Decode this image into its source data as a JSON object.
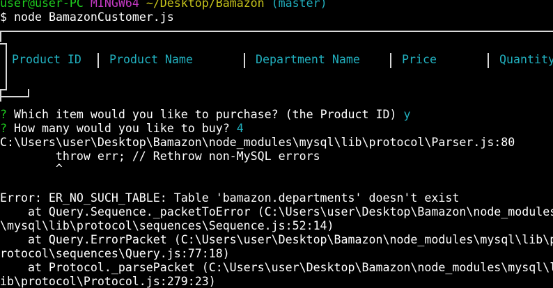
{
  "prompt": {
    "user_host": "user@user-PC",
    "shell": "MINGW64",
    "path": "~/Desktop/Bamazon",
    "branch": "(master)",
    "symbol": "$",
    "command": "node BamazonCustomer.js"
  },
  "table": {
    "headers": [
      "Product ID",
      "Product Name",
      "Department Name",
      "Price",
      "Quantity"
    ]
  },
  "questions": [
    {
      "marker": "?",
      "text": "Which item would you like to purchase? (the Product ID)",
      "answer": "y"
    },
    {
      "marker": "?",
      "text": "How many would you like to buy?",
      "answer": "4"
    }
  ],
  "error_output": {
    "location": "C:\\Users\\user\\Desktop\\Bamazon\\node_modules\\mysql\\lib\\protocol\\Parser.js:80",
    "code_line": "        throw err; // Rethrow non-MySQL errors",
    "caret": "        ^",
    "error_message": "Error: ER_NO_SUCH_TABLE: Table 'bamazon.departments' doesn't exist",
    "stack": [
      "    at Query.Sequence._packetToError (C:\\Users\\user\\Desktop\\Bamazon\\node_modules",
      "\\mysql\\lib\\protocol\\sequences\\Sequence.js:52:14)",
      "    at Query.ErrorPacket (C:\\Users\\user\\Desktop\\Bamazon\\node_modules\\mysql\\lib\\p",
      "rotocol\\sequences\\Query.js:77:18)",
      "    at Protocol._parsePacket (C:\\Users\\user\\Desktop\\Bamazon\\node_modules\\mysql\\l",
      "ib\\protocol\\Protocol.js:279:23)"
    ]
  },
  "colors": {
    "background": "#000000",
    "prompt_green": "#1fd01f",
    "shell_magenta": "#c43ac4",
    "path_yellow": "#c8c51b",
    "accent_cyan": "#21b0bf",
    "text": "#ffffff"
  }
}
